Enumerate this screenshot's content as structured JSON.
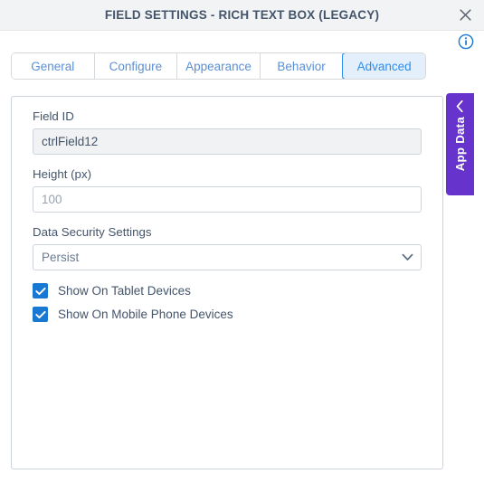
{
  "window": {
    "title": "FIELD SETTINGS - RICH TEXT BOX (LEGACY)",
    "close_icon": "close-icon",
    "info_icon": "info-icon"
  },
  "tabs": [
    {
      "label": "General",
      "active": false
    },
    {
      "label": "Configure",
      "active": false
    },
    {
      "label": "Appearance",
      "active": false
    },
    {
      "label": "Behavior",
      "active": false
    },
    {
      "label": "Advanced",
      "active": true
    }
  ],
  "form": {
    "field_id": {
      "label": "Field ID",
      "value": "ctrlField12",
      "placeholder": ""
    },
    "height": {
      "label": "Height (px)",
      "value": "",
      "placeholder": "100"
    },
    "data_security": {
      "label": "Data Security Settings",
      "value": "Persist",
      "caret_icon": "chevron-down-icon"
    },
    "checkboxes": [
      {
        "label": "Show On Tablet Devices",
        "checked": true
      },
      {
        "label": "Show On Mobile Phone Devices",
        "checked": true
      }
    ]
  },
  "app_data_tab": {
    "label": "App Data",
    "chevron_icon": "chevron-left-icon"
  },
  "colors": {
    "accent_blue": "#2d8cf0",
    "checkbox_blue": "#1878d2",
    "purple": "#6633cc",
    "header_bg": "#f1f3f4",
    "label_text": "#44546a"
  }
}
